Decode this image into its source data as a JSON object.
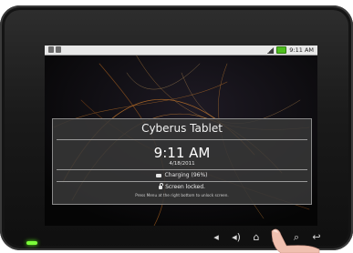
{
  "status_bar": {
    "time": "9:11 AM",
    "left_icons": [
      "usb-icon",
      "sd-card-icon"
    ],
    "right_icons": [
      "signal-icon",
      "battery-icon"
    ]
  },
  "lock_screen": {
    "device_name": "Cyberus Tablet",
    "time": "9:11 AM",
    "date": "4/18/2011",
    "charging_text": "Charging (96%)",
    "locked_text": "Screen locked.",
    "hint_text": "Press Menu at the right bottom to unlock screen."
  },
  "nav_buttons": [
    {
      "name": "volume-down-icon",
      "glyph": "◂"
    },
    {
      "name": "volume-up-icon",
      "glyph": "◂)"
    },
    {
      "name": "home-icon",
      "glyph": "⌂"
    },
    {
      "name": "menu-icon",
      "glyph": "▤"
    },
    {
      "name": "search-icon",
      "glyph": "⌕"
    },
    {
      "name": "back-icon",
      "glyph": "↩"
    }
  ],
  "colors": {
    "bezel": "#1a1a1a",
    "led": "#7cff3a",
    "battery": "#4fbf1f",
    "wallpaper_streak": "#c8782a"
  }
}
